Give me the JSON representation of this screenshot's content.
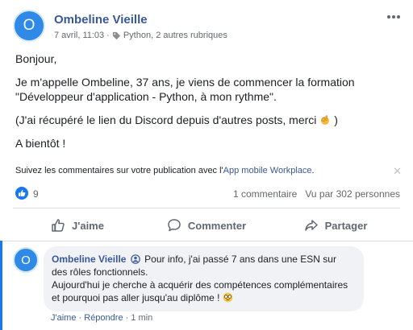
{
  "post": {
    "author": "Ombeline Vieille",
    "avatar_letter": "O",
    "date": "7 avril, 11:03",
    "separator": "·",
    "topic": "Python, 2 autres rubriques",
    "paragraphs": {
      "greeting": "Bonjour,",
      "intro_line1": "Je m'appelle Ombeline, 37 ans, je viens de commencer la formation",
      "intro_line2": "\"Développeur d'application - Python, à mon rythme\".",
      "discord": "(J'ai récupéré le lien du Discord depuis d'autres posts, merci",
      "discord_end": ")",
      "bye": "A bientôt !"
    }
  },
  "notice": {
    "text": "Suivez les commentaires sur votre publication avec l'",
    "link": "App mobile Workplace",
    "end": ".",
    "close": "✕"
  },
  "stats": {
    "likes": "9",
    "comments": "1 commentaire",
    "views": "Vu par 302 personnes"
  },
  "actions": {
    "like": "J'aime",
    "comment": "Commenter",
    "share": "Partager"
  },
  "comment": {
    "author": "Ombeline Vieille",
    "avatar_letter": "O",
    "text_line1": "Pour info, j'ai passé 7 ans dans une ESN sur",
    "text_line2": "des rôles fonctionnels.",
    "text_line3": "Aujourd'hui je cherche à acquérir des compétences complémentaires",
    "text_line4": "et pourquoi pas aller jusqu'au diplôme !",
    "like_label": "J'aime",
    "reply_label": "Répondre",
    "time": "1 min",
    "dot": "·"
  },
  "colors": {
    "brand": "#385898",
    "accent": "#1877f2",
    "avatar": "#2e8ae6"
  }
}
